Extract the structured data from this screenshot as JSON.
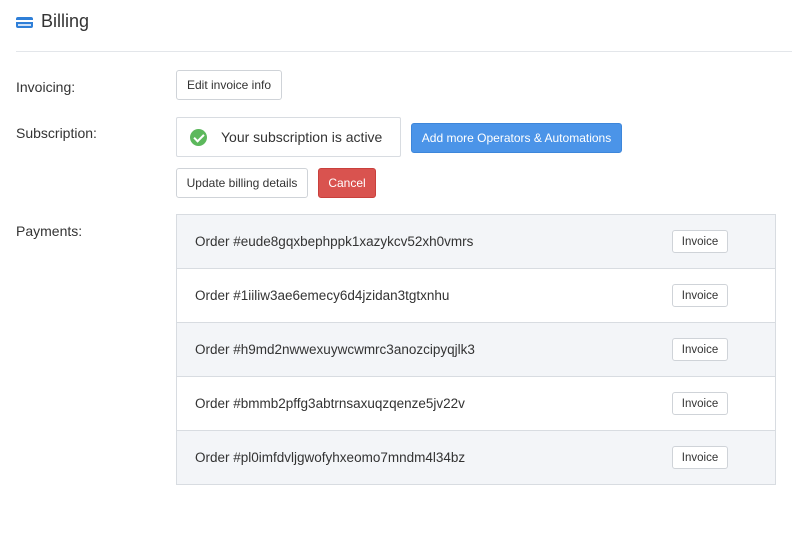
{
  "header": {
    "title": "Billing",
    "icon": "credit-card-icon"
  },
  "invoicing": {
    "label": "Invoicing:",
    "edit_button": "Edit invoice info"
  },
  "subscription": {
    "label": "Subscription:",
    "status": "Your subscription is active",
    "status_icon": "check-circle-icon",
    "add_button": "Add more Operators & Automations",
    "update_button": "Update billing details",
    "cancel_button": "Cancel"
  },
  "payments": {
    "label": "Payments:",
    "rows": [
      {
        "order": "Order #eude8gqxbephppk1xazykcv52xh0vmrs",
        "invoice_label": "Invoice"
      },
      {
        "order": "Order #1iiliw3ae6emecy6d4jzidan3tgtxnhu",
        "invoice_label": "Invoice"
      },
      {
        "order": "Order #h9md2nwwexuywcwmrc3anozcipyqjlk3",
        "invoice_label": "Invoice"
      },
      {
        "order": "Order #bmmb2pffg3abtrnsaxuqzqenze5jv22v",
        "invoice_label": "Invoice"
      },
      {
        "order": "Order #pl0imfdvljgwofyhxeomo7mndm4l34bz",
        "invoice_label": "Invoice"
      }
    ]
  },
  "colors": {
    "accent": "#4b94e8",
    "danger": "#d9534f",
    "success": "#5cb85c",
    "row_shade": "#f3f5f8"
  }
}
